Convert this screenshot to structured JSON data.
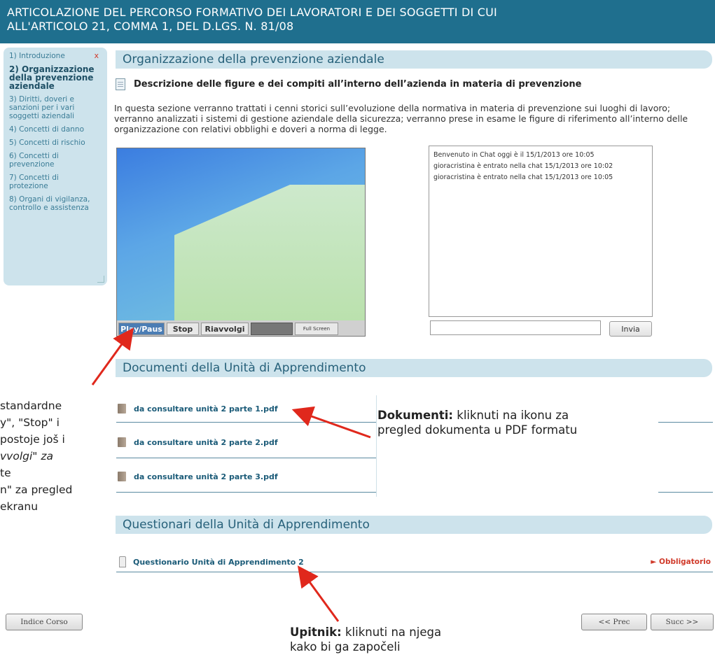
{
  "header": {
    "line1": "ARTICOLAZIONE DEL PERCORSO FORMATIVO DEI LAVORATORI E DEI SOGGETTI DI CUI",
    "line2": "ALL'ARTICOLO 21, COMMA 1, DEL D.LGS. N. 81/08"
  },
  "sidebar": {
    "close_glyph": "x",
    "items": [
      "1) Introduzione",
      "2) Organizzazione della prevenzione aziendale",
      "3) Diritti, doveri e sanzioni per i vari soggetti aziendali",
      "4) Concetti di danno",
      "5) Concetti di rischio",
      "6) Concetti di prevenzione",
      "7) Concetti di protezione",
      "8) Organi di vigilanza, controllo e assistenza"
    ]
  },
  "main": {
    "section_title": "Organizzazione della prevenzione aziendale",
    "desc_title": "Descrizione delle figure e dei compiti all’interno dell’azienda in materia di prevenzione",
    "intro": "In questa sezione verranno trattati i cenni storici sull’evoluzione della normativa in materia di prevenzione sui luoghi di lavoro; verranno analizzati i sistemi di gestione aziendale della sicurezza; verranno prese in esame le figure di riferimento all’interno delle organizzazione con relativi obblighi e doveri a norma di legge."
  },
  "video": {
    "play_label": "Play/Paus",
    "stop_label": "Stop",
    "rewind_label": "Riavvolgi",
    "fullscreen_label": "Full Screen"
  },
  "chat": {
    "lines": [
      "Benvenuto in Chat oggi è il 15/1/2013 ore 10:05",
      "gioracristina è entrato nella chat 15/1/2013 ore 10:02",
      "gioracristina è entrato nella chat 15/1/2013 ore 10:05"
    ],
    "send_label": "Invia"
  },
  "documents": {
    "title": "Documenti della Unità di Apprendimento",
    "files": [
      "da consultare unità 2 parte 1.pdf",
      "da consultare unità 2 parte 2.pdf",
      "da consultare unità 2 parte 3.pdf"
    ]
  },
  "questionnaires": {
    "title": "Questionari della Unità di Apprendimento",
    "item": "Questionario Unità di Apprendimento 2",
    "required": "► Obbligatorio"
  },
  "nav": {
    "index": "Indice Corso",
    "prev": "<< Prec",
    "next": "Succ >>"
  },
  "annotations": {
    "left_lines": [
      "standardne",
      "y\", \"Stop\" i",
      "postoje još i",
      "vvolgi\" za",
      "te",
      "n\" za pregled",
      "ekranu"
    ],
    "documents_bold": "Dokumenti:",
    "documents_line1": " kliknuti na ikonu za",
    "documents_line2": "pregled dokumenta u PDF formatu",
    "quiz_bold": "Upitnik:",
    "quiz_line1": " kliknuti na njega",
    "quiz_line2": "kako bi ga započeli"
  }
}
